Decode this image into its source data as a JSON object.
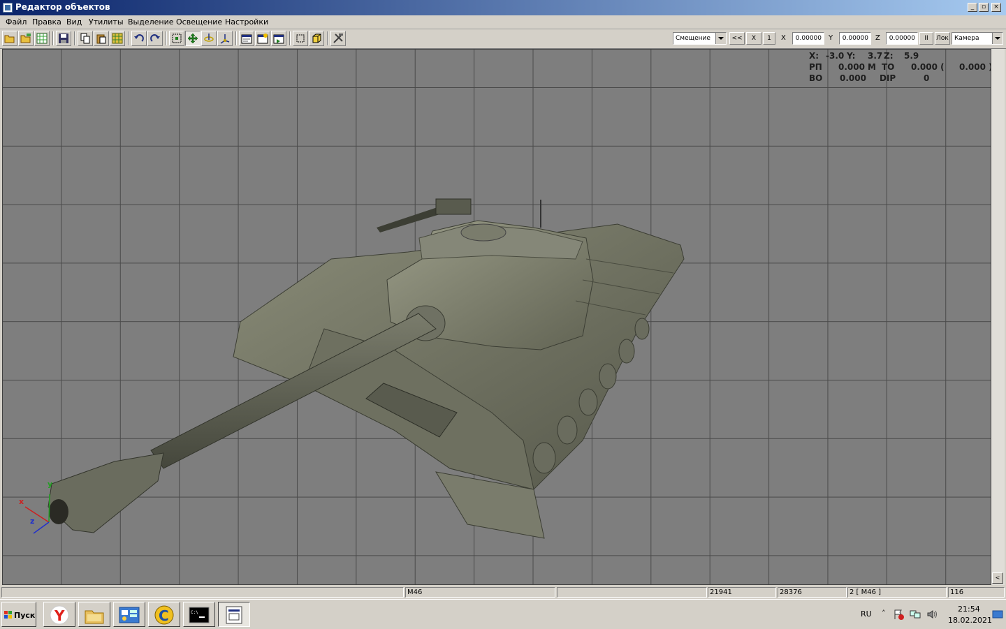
{
  "window": {
    "title": "Редактор объектов"
  },
  "menu": [
    "Файл",
    "Правка",
    "Вид",
    "Утилиты",
    "Выделение",
    "Освещение",
    "Настройки"
  ],
  "toolbar": {
    "mode_select": "Смещение",
    "back_btn": "<<",
    "x_btn": "X",
    "one_btn": "1",
    "x_label": "X",
    "x_value": "0.00000",
    "y_label": "Y",
    "y_value": "0.00000",
    "z_label": "Z",
    "z_value": "0.00000",
    "pause_btn": "II",
    "lok_btn": "Лок",
    "camera_select": "Камера"
  },
  "hud": {
    "line1": [
      "X:",
      "-3.0",
      "Y:",
      "3.7",
      "Z:",
      "5.9"
    ],
    "line2": [
      "РП",
      "0.000",
      "М",
      "ТО",
      "0.000 (",
      "0.000 )"
    ],
    "line3": [
      "ВО",
      "0.000",
      "DIP",
      "0"
    ]
  },
  "axes": {
    "x": "x",
    "y": "y",
    "z": "z"
  },
  "status": [
    "",
    "M46",
    "",
    "21941",
    "28376",
    "2 [ M46 ]",
    "116"
  ],
  "taskbar": {
    "start_label": "Пуск",
    "lang": "RU",
    "time": "21:54",
    "date": "18.02.2021"
  },
  "colors": {
    "title_start": "#0a246a",
    "title_end": "#a6caf0",
    "viewport": "#7e7e7e",
    "grid": "#4a4a4a",
    "axis_x": "#cc2020",
    "axis_y": "#20a020",
    "axis_z": "#2030cc"
  }
}
